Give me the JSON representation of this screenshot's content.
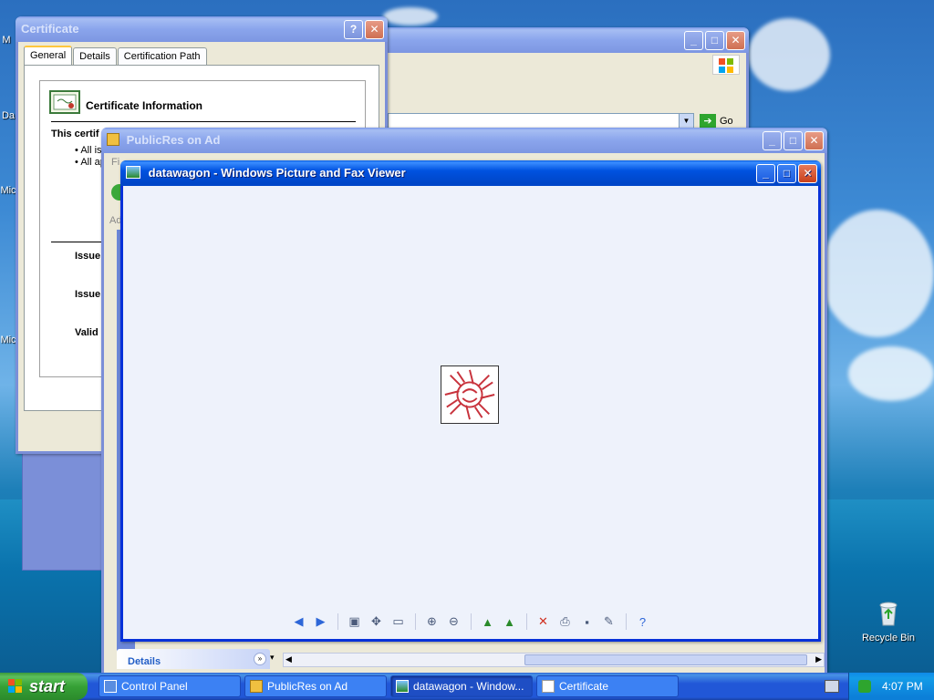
{
  "desktop": {
    "icons": [
      {
        "label": "Recycle Bin"
      }
    ]
  },
  "background_window": {
    "go_label": "Go"
  },
  "certificate": {
    "title": "Certificate",
    "tabs": [
      "General",
      "Details",
      "Certification Path"
    ],
    "heading": "Certificate Information",
    "this_cert": "This certif",
    "bullets": [
      "All iss",
      "All ap"
    ],
    "fields": [
      "Issue",
      "Issue",
      "Valid"
    ]
  },
  "publicres": {
    "title": "PublicRes on Ad",
    "menu_fragment": "Fi",
    "address_fragment": "Ad",
    "details_label": "Details"
  },
  "viewer": {
    "title": "datawagon - Windows Picture and Fax Viewer",
    "toolbar": [
      {
        "name": "previous-image-button",
        "icon": "◀"
      },
      {
        "name": "next-image-button",
        "icon": "▶"
      },
      {
        "sep": true
      },
      {
        "name": "best-fit-button",
        "icon": "▣"
      },
      {
        "name": "actual-size-button",
        "icon": "✥"
      },
      {
        "name": "slideshow-button",
        "icon": "▭"
      },
      {
        "sep": true
      },
      {
        "name": "zoom-in-button",
        "icon": "⊕"
      },
      {
        "name": "zoom-out-button",
        "icon": "⊖"
      },
      {
        "sep": true
      },
      {
        "name": "rotate-clockwise-button",
        "icon": "▲"
      },
      {
        "name": "rotate-counterclockwise-button",
        "icon": "▲"
      },
      {
        "sep": true
      },
      {
        "name": "delete-button",
        "icon": "✕"
      },
      {
        "name": "print-button",
        "icon": "⎙"
      },
      {
        "name": "save-button",
        "icon": "▪"
      },
      {
        "name": "open-for-editing-button",
        "icon": "✎"
      },
      {
        "sep": true
      },
      {
        "name": "help-button",
        "icon": "?"
      }
    ]
  },
  "taskbar": {
    "start_label": "start",
    "tasks": [
      {
        "label": "Control Panel",
        "active": false
      },
      {
        "label": "PublicRes on Ad",
        "active": false
      },
      {
        "label": "datawagon - Window...",
        "active": true
      },
      {
        "label": "Certificate",
        "active": false
      }
    ],
    "clock": "4:07 PM"
  },
  "colors": {
    "xp_blue": "#0831d9",
    "start_green": "#36a136",
    "close_red": "#c8401c"
  }
}
